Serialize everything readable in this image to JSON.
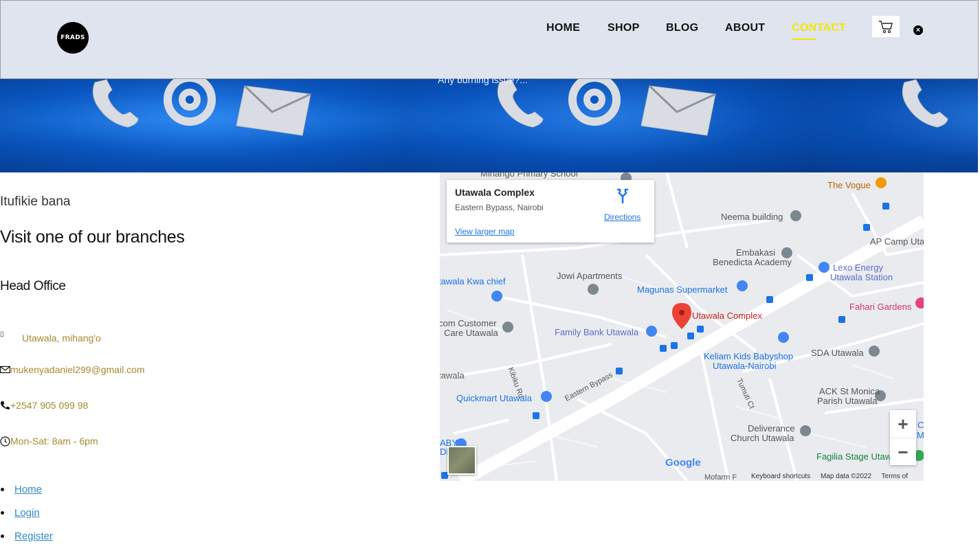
{
  "header": {
    "logo_text": "FRADS",
    "nav": [
      "HOME",
      "SHOP",
      "BLOG",
      "ABOUT",
      "CONTACT"
    ],
    "active_nav": "CONTACT",
    "cart_icon": "cart-icon",
    "close_icon": "close-icon"
  },
  "banner": {
    "text": "Any burning issue?..."
  },
  "contact": {
    "lead": "Itufikie bana",
    "title": "Visit one of our branches",
    "office": "Head Office",
    "address": "Utawala, mihang'o",
    "email": "mukenyadaniel299@gmail.com",
    "phone": "+2547 905 099 98",
    "hours": "Mon-Sat: 8am - 6pm"
  },
  "links": [
    "Home",
    "Login",
    "Register"
  ],
  "map": {
    "place_title": "Utawala Complex",
    "place_address": "Eastern Bypass, Nairobi",
    "view_larger": "View larger map",
    "directions": "Directions",
    "labels": {
      "mihango_school": "Mihango Primary School",
      "the_vogue": "The Vogue",
      "neema": "Neema building",
      "ap_camp": "AP Camp Uta",
      "embakasi1": "Embakasi",
      "embakasi2": "Benedicta Academy",
      "lexo1": "Lexo Energy",
      "lexo2": "Utawala Station",
      "jowi": "Jowi Apartments",
      "kwa_chief": "tawala Kwa chief",
      "magunas": "Magunas Supermarket",
      "fahari": "Fahari Gardens",
      "customer1": "com Customer",
      "customer2": "Care Utawala",
      "family_bank": "Family Bank Utawala",
      "utawala_complex": "Utawala Complex",
      "keliam1": "Keliam Kids Babyshop",
      "keliam2": "Utawala-Nairobi",
      "sda": "SDA Utawala",
      "kibiku": "Kibiku Rd",
      "tawala": "tawala",
      "eastern_bypass": "Eastern Bypass",
      "tumuti": "Tumuti Ct",
      "quickmart": "Quickmart Utawala",
      "ack1": "ACK St Monica",
      "ack2": "Parish Utawala",
      "deliverance1": "Deliverance",
      "deliverance2": "Church Utawala",
      "cm1": "C",
      "cm2": "Ma",
      "fagilia": "Fagilia Stage Utaw",
      "aby": "ABY",
      "de": "DE",
      "mofarm": "Mofarm F"
    },
    "google": "Google",
    "keyboard": "Keyboard shortcuts",
    "map_data": "Map data ©2022",
    "terms": "Terms of Use",
    "zoom_in": "+",
    "zoom_out": "−"
  }
}
